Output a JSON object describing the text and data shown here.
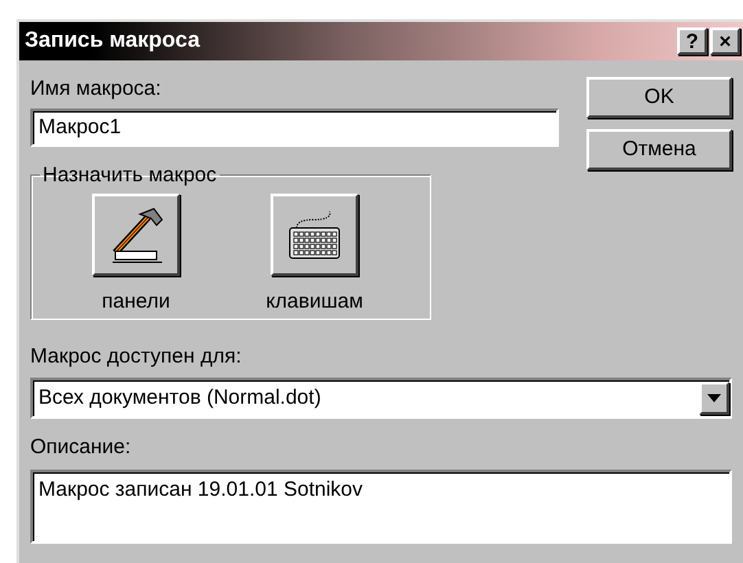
{
  "window": {
    "title": "Запись макроса",
    "title_buttons": [
      "?",
      "×"
    ]
  },
  "macro_name": {
    "label": "Имя макроса:",
    "value": "Макрос1"
  },
  "buttons": [
    "OK",
    "Отмена"
  ],
  "assign": {
    "title": "Назначить макрос",
    "targets": [
      {
        "kind": "toolbar",
        "label": "панели"
      },
      {
        "kind": "keyboard",
        "label": "клавишам"
      }
    ]
  },
  "store_in": {
    "label": "Макрос доступен для:",
    "value": "Всех документов (Normal.dot)"
  },
  "description": {
    "label": "Описание:",
    "value": "Макрос записан 19.01.01 Sotnikov"
  }
}
